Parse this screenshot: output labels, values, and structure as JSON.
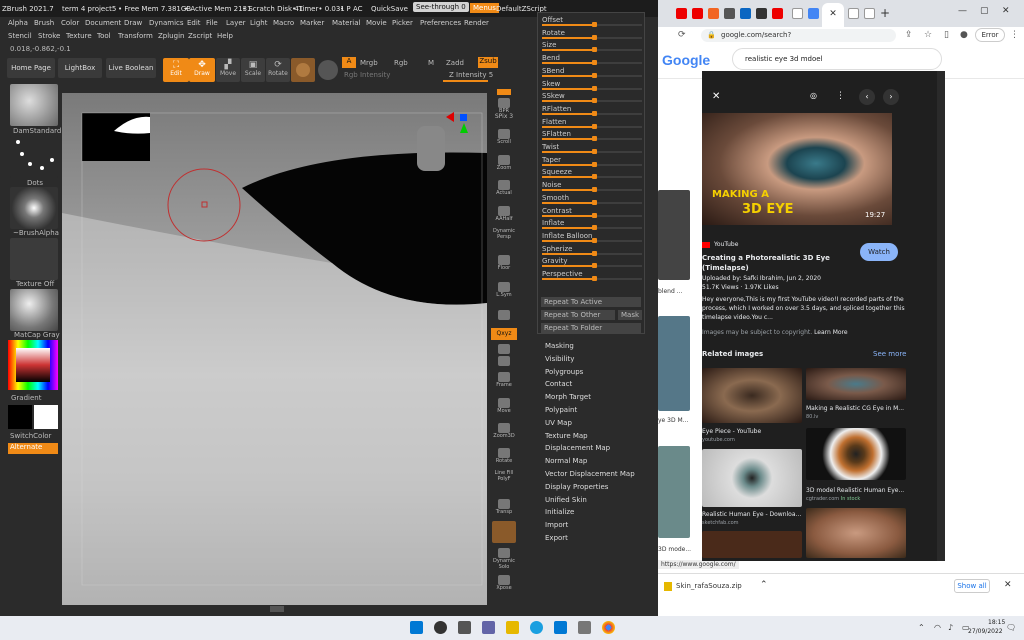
{
  "zbrush": {
    "title": "ZBrush 2021.7",
    "project": "term 4 project5",
    "free_mem": "• Free Mem 7.381GB",
    "active_mem": "• Active Mem 2131",
    "scratch": "• Scratch Disk 41",
    "timer": "• Timer• 0.031",
    "pa": "• P",
    "ac": "AC",
    "quicksave": "QuickSave",
    "see_through": "See-through  0",
    "menus": "Menus",
    "default_script": "DefaultZScript",
    "menu_row1": [
      "Alpha",
      "Brush",
      "Color",
      "Document",
      "Draw",
      "Dynamics",
      "Edit",
      "File",
      "Layer",
      "Light",
      "Macro",
      "Marker",
      "Material",
      "Movie",
      "Picker",
      "Preferences",
      "Render"
    ],
    "menu_row2": [
      "Stencil",
      "Stroke",
      "Texture",
      "Tool",
      "Transform",
      "Zplugin",
      "Zscript",
      "Help"
    ],
    "coords": "0.018,-0.862,-0.1",
    "home_page": "Home Page",
    "lightbox": "LightBox",
    "live_boolean": "Live Boolean",
    "tool_edit": "Edit",
    "tool_draw": "Draw",
    "tool_move": "Move",
    "tool_scale": "Scale",
    "tool_rotate": "Rotate",
    "a_label": "A",
    "mrgb": "Mrgb",
    "rgb": "Rgb",
    "m": "M",
    "zadd": "Zadd",
    "zsub": "Zsub",
    "rgb_intensity": "Rgb Intensity",
    "z_intensity": "Z Intensity 5",
    "brush_label": "DamStandard",
    "stroke_label": "Dots",
    "alpha_label": "~BrushAlpha",
    "texture_label": "Texture Off",
    "material_label": "MatCap Gray",
    "gradient": "Gradient",
    "switch_color": "SwitchColor",
    "alternate": "Alternate",
    "right_shelf": [
      "BPR",
      "SPix 3",
      "Scroll",
      "Zoom",
      "Actual",
      "AAHalf",
      "Dynamic Persp",
      "Floor",
      "L.Sym",
      "Qxyz",
      "",
      "",
      "Frame",
      "Move",
      "Zoom3D",
      "Rotate",
      "Line Fill PolyF",
      "Transp",
      "",
      "Dynamic Solo",
      "Xpose"
    ],
    "deformation": [
      "Offset",
      "Rotate",
      "Size",
      "Bend",
      "SBend",
      "Skew",
      "SSkew",
      "RFlatten",
      "Flatten",
      "SFlatten",
      "Twist",
      "Taper",
      "Squeeze",
      "Noise",
      "Smooth",
      "Contrast",
      "Inflate",
      "Inflate Balloon",
      "Spherize",
      "Gravity",
      "Perspective"
    ],
    "repeat_to_active": "Repeat To Active",
    "repeat_to_other": "Repeat To Other",
    "mask_btn": "Mask",
    "repeat_to_folder": "Repeat To Folder",
    "subpalettes": [
      "Masking",
      "Visibility",
      "Polygroups",
      "Contact",
      "Morph Target",
      "Polypaint",
      "UV Map",
      "Texture Map",
      "Displacement Map",
      "Normal Map",
      "Vector Displacement Map",
      "Display Properties",
      "Unified Skin",
      "Initialize",
      "Import",
      "Export"
    ]
  },
  "chrome": {
    "url": "google.com/search?q=realistic+eye+3d+mdoel&tb...",
    "error_btn": "Error",
    "search_query": "realistic eye 3d mdoel",
    "logo": "Google",
    "video_overlay_line1": "MAKING A",
    "video_overlay_line2": "3D EYE",
    "duration": "19:27",
    "source": "YouTube",
    "video_title": "Creating a Photorealistic 3D Eye (Timelapse)",
    "uploaded_by": "Uploaded by: Safki Ibrahim, Jun 2, 2020",
    "views": "51.7K Views · 1.97K Likes",
    "description": "Hey everyone,This is my first YouTube video!I recorded parts of the process, which I worked on over 3.5 days, and spliced together this timelapse video.You c...",
    "watch": "Watch",
    "copyright": "Images may be subject to copyright.",
    "learn_more": "Learn More",
    "related": "Related images",
    "see_more": "See more",
    "related_items": [
      {
        "title": "Eye Piece - YouTube",
        "source": "youtube.com",
        "extra": ""
      },
      {
        "title": "Making a Realistic CG Eye in M...",
        "source": "80.lv",
        "extra": ""
      },
      {
        "title": "Realistic Human Eye - Downloa...",
        "source": "sketchfab.com",
        "extra": ""
      },
      {
        "title": "3D model Realistic Human Eye...",
        "source": "cgtrader.com",
        "extra": "In stock"
      }
    ],
    "left_snips": [
      "blend ...",
      "ye 3D M...",
      "3D mode..."
    ],
    "status_url": "https://www.google.com/",
    "download_file": "Skin_rafaSouza.zip",
    "show_all": "Show all"
  },
  "taskbar": {
    "time": "18:15",
    "date": "27/09/2022"
  }
}
